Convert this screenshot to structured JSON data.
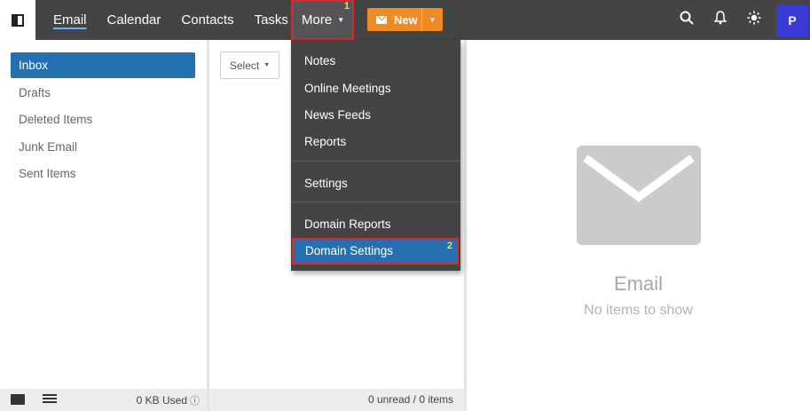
{
  "nav": {
    "items": [
      "Email",
      "Calendar",
      "Contacts",
      "Tasks"
    ],
    "more_label": "More",
    "more_marker": "1",
    "new_label": "New"
  },
  "header_right": {
    "avatar_initial": "P"
  },
  "folders": [
    "Inbox",
    "Drafts",
    "Deleted Items",
    "Junk Email",
    "Sent Items"
  ],
  "list": {
    "select_label": "Select"
  },
  "more_menu": {
    "group1": [
      "Notes",
      "Online Meetings",
      "News Feeds",
      "Reports"
    ],
    "group2": [
      "Settings"
    ],
    "group3": [
      "Domain Reports",
      "Domain Settings"
    ],
    "highlight_marker": "2"
  },
  "reading": {
    "title": "Email",
    "subtitle": "No items to show"
  },
  "footer": {
    "storage_used": "0 KB Used",
    "counts": "0 unread / 0 items"
  },
  "colors": {
    "topbar": "#444444",
    "accent": "#2470b0",
    "new_button": "#f08a24",
    "callout": "#e0262d"
  }
}
